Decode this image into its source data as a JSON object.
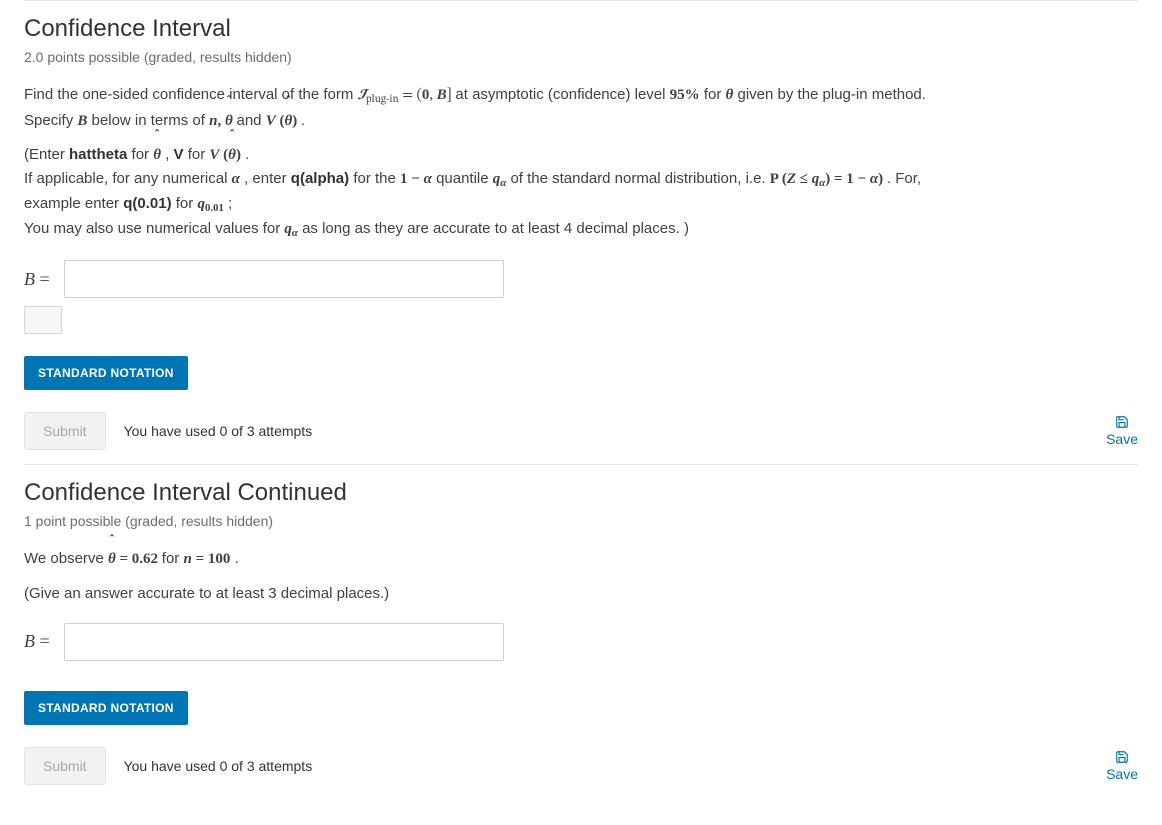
{
  "sections": [
    {
      "title": "Confidence Interval",
      "points": "2.0 points possible (graded, results hidden)",
      "intro1_pre": "Find the one-sided confidence interval of the form ",
      "intro1_formula": "𝓘plug-in = (0, B]",
      "intro1_mid": " at asymptotic (confidence) level ",
      "conf_level": "95%",
      "intro1_mid2": " for ",
      "theta": "θ",
      "intro1_post": " given by the plug-in method.",
      "specify_pre": "Specify ",
      "specify_B": "B",
      "specify_mid": " below in terms of ",
      "specify_vars": "n, θ̂",
      "specify_mid2": "  and ",
      "specify_V": "V (θ̂)",
      "specify_post": ".",
      "enter_pre": "(Enter ",
      "hattheta": "hattheta",
      "enter_mid1": " for ",
      "enter_hatth": "θ̂",
      "enter_mid2": ", ",
      "V": "V",
      "enter_mid3": " for ",
      "enter_Vhat": "V (θ̂)",
      "enter_post": ".",
      "line3_pre": "If applicable, for any numerical ",
      "alpha": "α",
      "line3_mid1": ", enter ",
      "qalpha": "q(alpha)",
      "line3_mid2": " for the ",
      "one_minus_alpha": "1 − α",
      "line3_mid3": " quantile ",
      "q_alpha_sym": "qα",
      "line3_mid4": " of the standard normal distribution, i.e. ",
      "prob_expr": "P (Z ≤ qα) = 1 − α)",
      "line3_end": ". For,",
      "line4_pre": "example enter ",
      "q001": "q(0.01)",
      "line4_mid": " for ",
      "q001sym": "q0.01",
      "line4_post": ";",
      "line5_pre": "You may also use numerical values for ",
      "line5_qalpha": "qα",
      "line5_post": " as long as they are accurate to at least 4 decimal places. )",
      "answer_label": "B =",
      "std_btn": "STANDARD NOTATION",
      "submit": "Submit",
      "attempts": "You have used 0 of 3 attempts",
      "save": "Save"
    },
    {
      "title": "Confidence Interval Continued",
      "points": "1 point possible (graded, results hidden)",
      "obs_pre": "We observe ",
      "obs_theta": "θ̂ = 0.62",
      "obs_mid": " for ",
      "obs_n": "n = 100",
      "obs_post": ".",
      "accuracy": "(Give an answer accurate to at least 3 decimal places.)",
      "answer_label": "B =",
      "std_btn": "STANDARD NOTATION",
      "submit": "Submit",
      "attempts": "You have used 0 of 3 attempts",
      "save": "Save"
    }
  ]
}
